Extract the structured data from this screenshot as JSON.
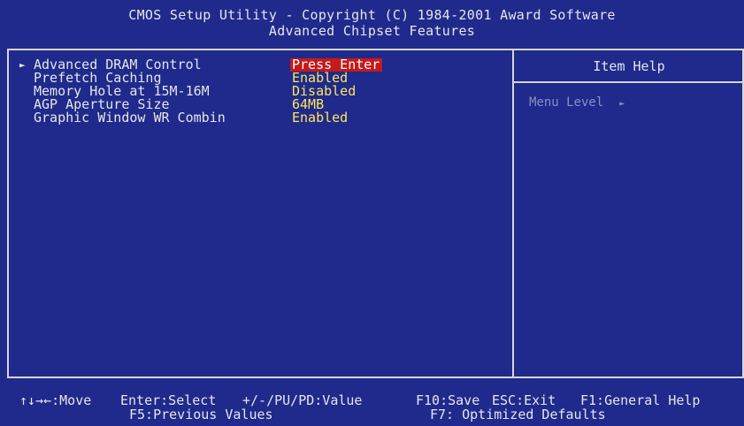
{
  "header": {
    "line1": "CMOS Setup Utility - Copyright (C) 1984-2001 Award Software",
    "line2": "Advanced Chipset Features"
  },
  "settings": [
    {
      "label": "Advanced DRAM Control",
      "value": "Press Enter",
      "submenu_marker": "►",
      "selected": true
    },
    {
      "label": "Prefetch Caching",
      "value": "Enabled"
    },
    {
      "label": "Memory Hole at 15M-16M",
      "value": "Disabled"
    },
    {
      "label": "AGP Aperture Size",
      "value": "64MB"
    },
    {
      "label": "Graphic Window WR Combin",
      "value": "Enabled"
    }
  ],
  "help": {
    "title": "Item Help",
    "menu_level_label": "Menu Level",
    "menu_level_marker": "►"
  },
  "footer": {
    "move": "↑↓→←:Move",
    "enter": "Enter:Select",
    "value": "+/-/PU/PD:Value",
    "save": "F10:Save",
    "exit": "ESC:Exit",
    "general_help": "F1:General Help",
    "prev_values": "F5:Previous Values",
    "optimized": "F7: Optimized Defaults"
  },
  "colors": {
    "background": "#1f2a8c",
    "value_text": "#ffe45a",
    "highlight": "#c41a1a",
    "border": "#d6d6d6"
  }
}
